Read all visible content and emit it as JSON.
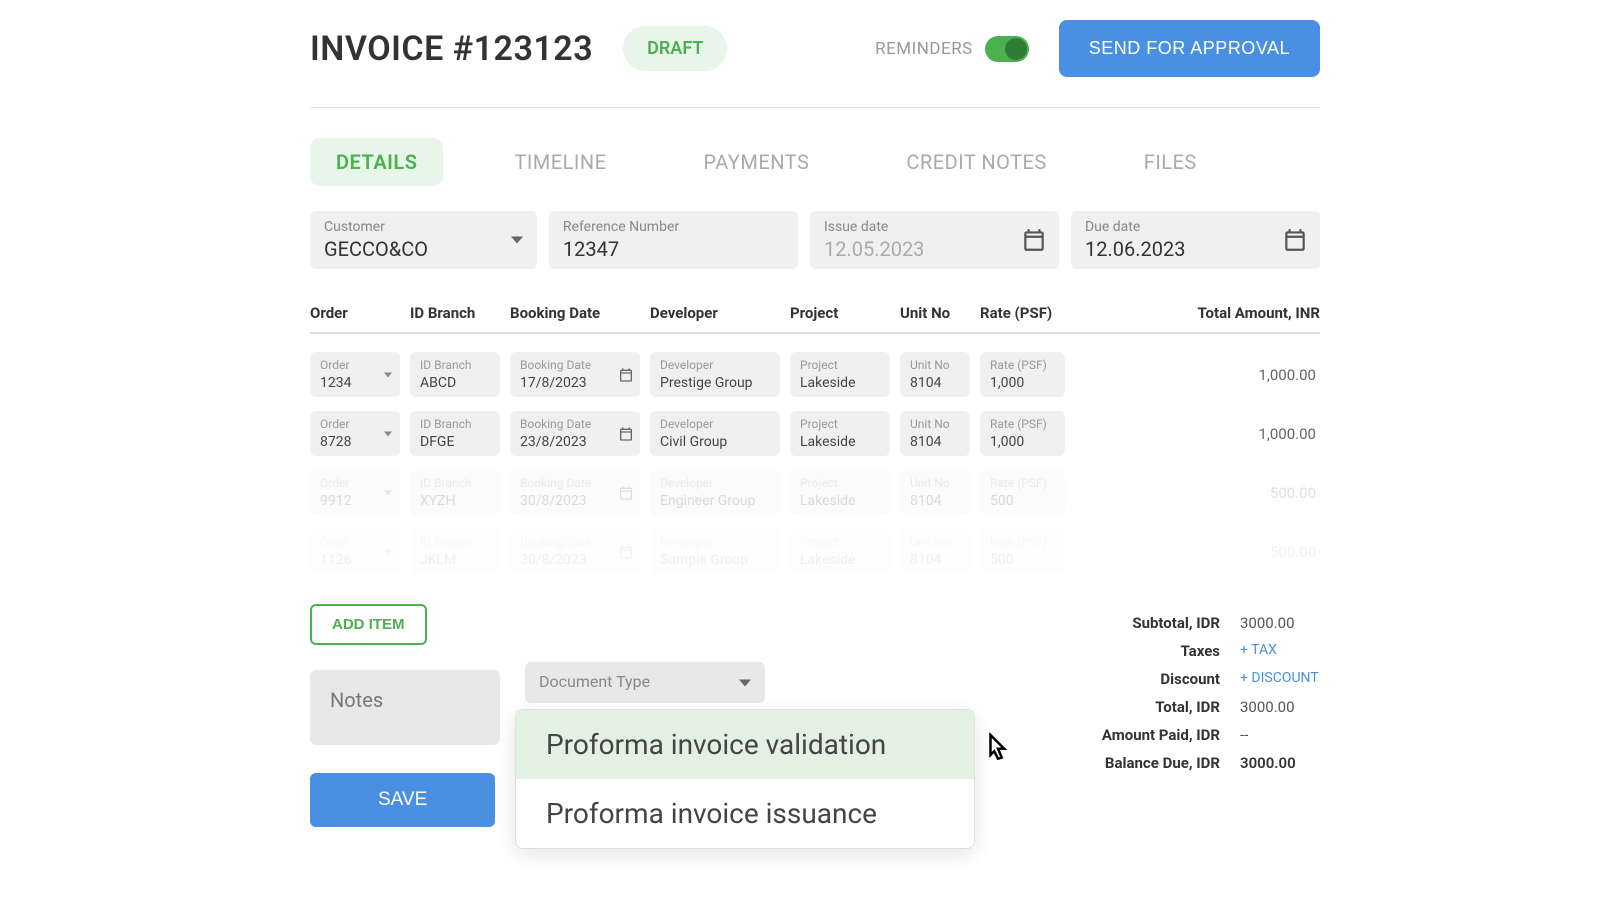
{
  "header": {
    "title": "INVOICE #123123",
    "status_label": "DRAFT",
    "reminders_label": "REMINDERS",
    "approve_label": "SEND FOR APPROVAL"
  },
  "tabs": {
    "details": "DETAILS",
    "timeline": "TIMELINE",
    "payments": "PAYMENTS",
    "credit_notes": "CREDIT NOTES",
    "files": "FILES"
  },
  "form": {
    "customer_label": "Customer",
    "customer_value": "GECCO&CO",
    "ref_label": "Reference Number",
    "ref_value": "12347",
    "issue_label": "Issue date",
    "issue_value": "12.05.2023",
    "due_label": "Due date",
    "due_value": "12.06.2023"
  },
  "table": {
    "headers": {
      "order": "Order",
      "branch": "ID Branch",
      "booking": "Booking Date",
      "developer": "Developer",
      "project": "Project",
      "unit": "Unit No",
      "rate": "Rate (PSF)",
      "total": "Total Amount, INR"
    },
    "cell_labels": {
      "order": "Order",
      "branch": "ID Branch",
      "booking": "Booking Date",
      "developer": "Developer",
      "project": "Project",
      "unit": "Unit No",
      "rate": "Rate (PSF)"
    },
    "rows": [
      {
        "order": "1234",
        "branch": "ABCD",
        "booking": "17/8/2023",
        "developer": "Prestige Group",
        "project": "Lakeside",
        "unit": "8104",
        "rate": "1,000",
        "total": "1,000.00"
      },
      {
        "order": "8728",
        "branch": "DFGE",
        "booking": "23/8/2023",
        "developer": "Civil Group",
        "project": "Lakeside",
        "unit": "8104",
        "rate": "1,000",
        "total": "1,000.00"
      },
      {
        "order": "9912",
        "branch": "XYZH",
        "booking": "30/8/2023",
        "developer": "Engineer Group",
        "project": "Lakeside",
        "unit": "8104",
        "rate": "500",
        "total": "500.00"
      },
      {
        "order": "1126",
        "branch": "JKLM",
        "booking": "30/8/2023",
        "developer": "Sample Group",
        "project": "Lakeside",
        "unit": "8104",
        "rate": "500",
        "total": "500.00"
      }
    ]
  },
  "actions": {
    "add_item": "ADD ITEM",
    "notes_placeholder": "Notes",
    "doc_type_label": "Document Type",
    "save_label": "SAVE"
  },
  "dropdown": {
    "option1": "Proforma invoice validation",
    "option2": "Proforma invoice issuance"
  },
  "summary": {
    "subtotal_label": "Subtotal, IDR",
    "subtotal_value": "3000.00",
    "taxes_label": "Taxes",
    "taxes_link": "+ TAX",
    "discount_label": "Discount",
    "discount_link": "+ DISCOUNT",
    "total_label": "Total, IDR",
    "total_value": "3000.00",
    "paid_label": "Amount Paid, IDR",
    "paid_value": "--",
    "balance_label": "Balance Due, IDR",
    "balance_value": "3000.00"
  }
}
